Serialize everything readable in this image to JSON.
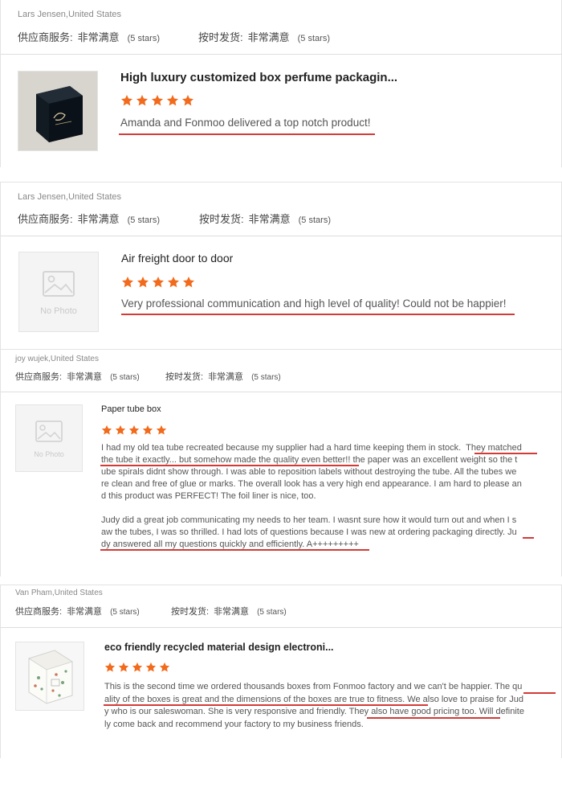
{
  "labels": {
    "supplier_service": "供应商服务:",
    "on_time_shipping": "按时发货:",
    "very_satisfied": "非常满意",
    "five_stars": "(5 stars)",
    "no_photo": "No Photo"
  },
  "colors": {
    "star": "#f26a1b",
    "underline": "#d23b36"
  },
  "reviews": [
    {
      "reviewer": "Lars Jensen,United States",
      "product_title": "High luxury customized box perfume packagin...",
      "stars": 5,
      "image": "perfume-box-photo",
      "body": "Amanda and Fonmoo delivered a top notch product!"
    },
    {
      "reviewer": "Lars Jensen,United States",
      "product_title": "Air freight door to door",
      "stars": 5,
      "image": "no-photo",
      "body": "Very professional communication and high level of quality! Could not be happier!"
    },
    {
      "reviewer": "joy wujek,United States",
      "product_title": "Paper tube box",
      "stars": 5,
      "image": "no-photo",
      "body_lines": [
        "I had my old tea tube recreated because my supplier had a hard time keeping them in stock.  They matched",
        "the tube it exactly... but somehow made the quality even better!! the paper was an excellent weight so the t",
        "ube spirals didnt show through. I was able to reposition labels without destroying the tube. All the tubes we",
        "re clean and free of glue or marks. The overall look has a very high end appearance. I am hard to please an",
        "d this product was PERFECT! The foil liner is nice, too.",
        "",
        "Judy did a great job communicating my needs to her team. I wasnt sure how it would turn out and when I s",
        "aw the tubes, I was so thrilled. I had lots of questions because I was new at ordering packaging directly. Ju",
        "dy answered all my questions quickly and efficiently. A+++++++++"
      ]
    },
    {
      "reviewer": "Van Pham,United States",
      "product_title": "eco friendly recycled material design electroni...",
      "stars": 5,
      "image": "floral-box-photo",
      "body_lines": [
        "This is the second time we ordered thousands boxes from Fonmoo factory and we can't be happier. The qu",
        "ality of the boxes is great and the dimensions of the boxes are true to fitness. We also love to praise for Jud",
        "y who is our saleswoman. She is very responsive and friendly. They also have good pricing too. Will definite",
        "ly come back and recommend your factory to my business friends."
      ]
    }
  ]
}
